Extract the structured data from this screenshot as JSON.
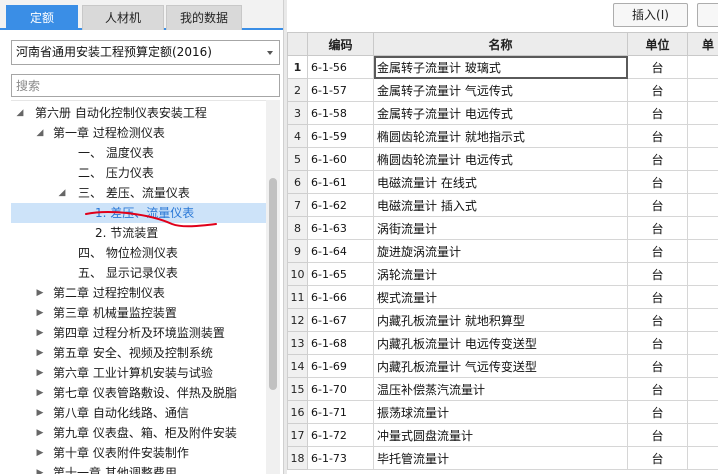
{
  "tabs": [
    {
      "label": "定额",
      "active": true
    },
    {
      "label": "人材机",
      "active": false
    },
    {
      "label": "我的数据",
      "active": false
    }
  ],
  "quota_select": {
    "value": "河南省通用安装工程预算定额(2016)"
  },
  "search": {
    "placeholder": "搜索"
  },
  "tree": [
    {
      "label": "第六册 自动化控制仪表安装工程",
      "level": 0,
      "arrow": "down"
    },
    {
      "label": "第一章 过程检测仪表",
      "level": 1,
      "arrow": "down"
    },
    {
      "label": "一、 温度仪表",
      "level": 2,
      "arrow": ""
    },
    {
      "label": "二、 压力仪表",
      "level": 2,
      "arrow": ""
    },
    {
      "label": "三、 差压、流量仪表",
      "level": 2,
      "arrow": "down"
    },
    {
      "label": "1. 差压、流量仪表",
      "level": 3,
      "arrow": "",
      "selected": true
    },
    {
      "label": "2. 节流装置",
      "level": 3,
      "arrow": ""
    },
    {
      "label": "四、 物位检测仪表",
      "level": 2,
      "arrow": ""
    },
    {
      "label": "五、 显示记录仪表",
      "level": 2,
      "arrow": ""
    },
    {
      "label": "第二章 过程控制仪表",
      "level": 1,
      "arrow": "right"
    },
    {
      "label": "第三章 机械量监控装置",
      "level": 1,
      "arrow": "right"
    },
    {
      "label": "第四章 过程分析及环境监测装置",
      "level": 1,
      "arrow": "right"
    },
    {
      "label": "第五章 安全、视频及控制系统",
      "level": 1,
      "arrow": "right"
    },
    {
      "label": "第六章 工业计算机安装与试验",
      "level": 1,
      "arrow": "right"
    },
    {
      "label": "第七章 仪表管路敷设、伴热及脱脂",
      "level": 1,
      "arrow": "right"
    },
    {
      "label": "第八章 自动化线路、通信",
      "level": 1,
      "arrow": "right"
    },
    {
      "label": "第九章 仪表盘、箱、柜及附件安装",
      "level": 1,
      "arrow": "right"
    },
    {
      "label": "第十章 仪表附件安装制作",
      "level": 1,
      "arrow": "right"
    },
    {
      "label": "第十一章 其他调整费用",
      "level": 1,
      "arrow": "right"
    }
  ],
  "toolbar": {
    "insert_label": "插入(I)",
    "more_label": ""
  },
  "grid": {
    "headers": [
      "",
      "编码",
      "名称",
      "单位",
      "单"
    ],
    "rows": [
      {
        "n": "1",
        "code": "6-1-56",
        "name": "金属转子流量计 玻璃式",
        "unit": "台"
      },
      {
        "n": "2",
        "code": "6-1-57",
        "name": "金属转子流量计 气远传式",
        "unit": "台"
      },
      {
        "n": "3",
        "code": "6-1-58",
        "name": "金属转子流量计 电远传式",
        "unit": "台"
      },
      {
        "n": "4",
        "code": "6-1-59",
        "name": "椭圆齿轮流量计 就地指示式",
        "unit": "台"
      },
      {
        "n": "5",
        "code": "6-1-60",
        "name": "椭圆齿轮流量计 电远传式",
        "unit": "台"
      },
      {
        "n": "6",
        "code": "6-1-61",
        "name": "电磁流量计 在线式",
        "unit": "台"
      },
      {
        "n": "7",
        "code": "6-1-62",
        "name": "电磁流量计 插入式",
        "unit": "台"
      },
      {
        "n": "8",
        "code": "6-1-63",
        "name": "涡街流量计",
        "unit": "台"
      },
      {
        "n": "9",
        "code": "6-1-64",
        "name": "旋进旋涡流量计",
        "unit": "台"
      },
      {
        "n": "10",
        "code": "6-1-65",
        "name": "涡轮流量计",
        "unit": "台"
      },
      {
        "n": "11",
        "code": "6-1-66",
        "name": "楔式流量计",
        "unit": "台"
      },
      {
        "n": "12",
        "code": "6-1-67",
        "name": "内藏孔板流量计 就地积算型",
        "unit": "台"
      },
      {
        "n": "13",
        "code": "6-1-68",
        "name": "内藏孔板流量计 电远传变送型",
        "unit": "台"
      },
      {
        "n": "14",
        "code": "6-1-69",
        "name": "内藏孔板流量计 气远传变送型",
        "unit": "台"
      },
      {
        "n": "15",
        "code": "6-1-70",
        "name": "温压补偿蒸汽流量计",
        "unit": "台"
      },
      {
        "n": "16",
        "code": "6-1-71",
        "name": "振荡球流量计",
        "unit": "台"
      },
      {
        "n": "17",
        "code": "6-1-72",
        "name": "冲量式圆盘流量计",
        "unit": "台"
      },
      {
        "n": "18",
        "code": "6-1-73",
        "name": "毕托管流量计",
        "unit": "台"
      }
    ]
  },
  "colors": {
    "accent": "#3a8ee6",
    "selected_bg": "#cde3f9",
    "annotation": "#e0001a"
  }
}
